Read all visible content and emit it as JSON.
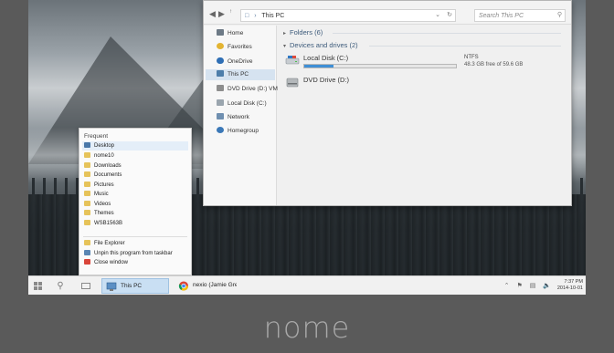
{
  "explorer": {
    "address": "This PC",
    "search_placeholder": "Search This PC",
    "nav": [
      "Home",
      "Favorites",
      "OneDrive",
      "This PC",
      "DVD Drive (D:) VMw",
      "Local Disk (C:)",
      "Network",
      "Homegroup"
    ],
    "selected_nav": "This PC",
    "groups": {
      "folders": "Folders (6)",
      "devices": "Devices and drives (2)"
    },
    "drives": [
      {
        "name": "Local Disk (C:)",
        "fs": "NTFS",
        "free_text": "48.3 GB free of 59.6 GB",
        "used_fraction": 0.19
      },
      {
        "name": "DVD Drive (D:)"
      }
    ]
  },
  "jumplist": {
    "header": "Frequent",
    "items": [
      {
        "label": "Desktop",
        "icon": "desktop-icon"
      },
      {
        "label": "nome10",
        "icon": "folder-icon"
      },
      {
        "label": "Downloads",
        "icon": "folder-icon"
      },
      {
        "label": "Documents",
        "icon": "folder-icon"
      },
      {
        "label": "Pictures",
        "icon": "folder-icon"
      },
      {
        "label": "Music",
        "icon": "folder-icon"
      },
      {
        "label": "Videos",
        "icon": "folder-icon"
      },
      {
        "label": "Themes",
        "icon": "folder-icon"
      },
      {
        "label": "WSB1563B",
        "icon": "folder-icon"
      }
    ],
    "tasks": [
      {
        "label": "File Explorer",
        "icon": "file-explorer-icon"
      },
      {
        "label": "Unpin this program from taskbar",
        "icon": "unpin-icon"
      },
      {
        "label": "Close window",
        "icon": "close-icon"
      }
    ]
  },
  "taskbar": {
    "explorer_label": "This PC",
    "chrome_label": "nexio (Jamie Gree...",
    "time": "7:37 PM",
    "date": "2014-10-01",
    "tray_icons": [
      "chevron-up-icon",
      "flag-icon",
      "network-icon",
      "volume-icon"
    ]
  },
  "brand": "nome",
  "colors": {
    "accent": "#3f8fd6",
    "selection": "#d6e3f0",
    "taskbar_active": "#c9dff3"
  }
}
